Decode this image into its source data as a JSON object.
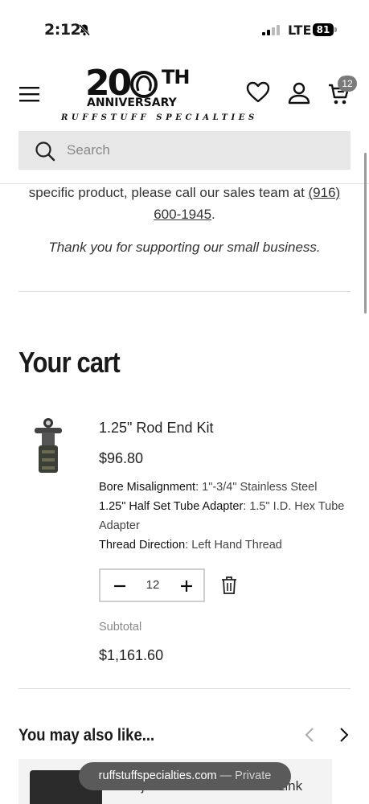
{
  "status_bar": {
    "time": "2:12",
    "network": "LTE",
    "battery": "81"
  },
  "header": {
    "logo_big": "20",
    "logo_th": "TH",
    "logo_anniversary": "ANNIVERSARY",
    "logo_brand": "RUFFSTUFF SPECIALTIES",
    "cart_count": "12"
  },
  "search": {
    "placeholder": "Search"
  },
  "notice": {
    "text": "specific product, please call our sales team at ",
    "phone": "(916) 600-1945",
    "end": ".",
    "thanks": "Thank you for supporting our small business."
  },
  "cart": {
    "title": "Your cart",
    "item": {
      "name": "1.25\" Rod End Kit",
      "price": "$96.80",
      "attributes": [
        {
          "label": "Bore Misalignment",
          "value": "1\"-3/4\" Stainless Steel"
        },
        {
          "label": "1.25\" Half Set Tube Adapter",
          "value": "1.5\" I.D. Hex Tube Adapter"
        },
        {
          "label": "Thread Direction",
          "value": "Left Hand Thread"
        }
      ],
      "quantity": "12",
      "subtotal_label": "Subtotal",
      "subtotal": "$1,161.60"
    }
  },
  "recommendations": {
    "title": "You may also like...",
    "first_card_title": "Adjustable Frame Mount Link"
  },
  "browser_toast": {
    "domain": "ruffstuffspecialties.com",
    "mode": "— Private"
  }
}
